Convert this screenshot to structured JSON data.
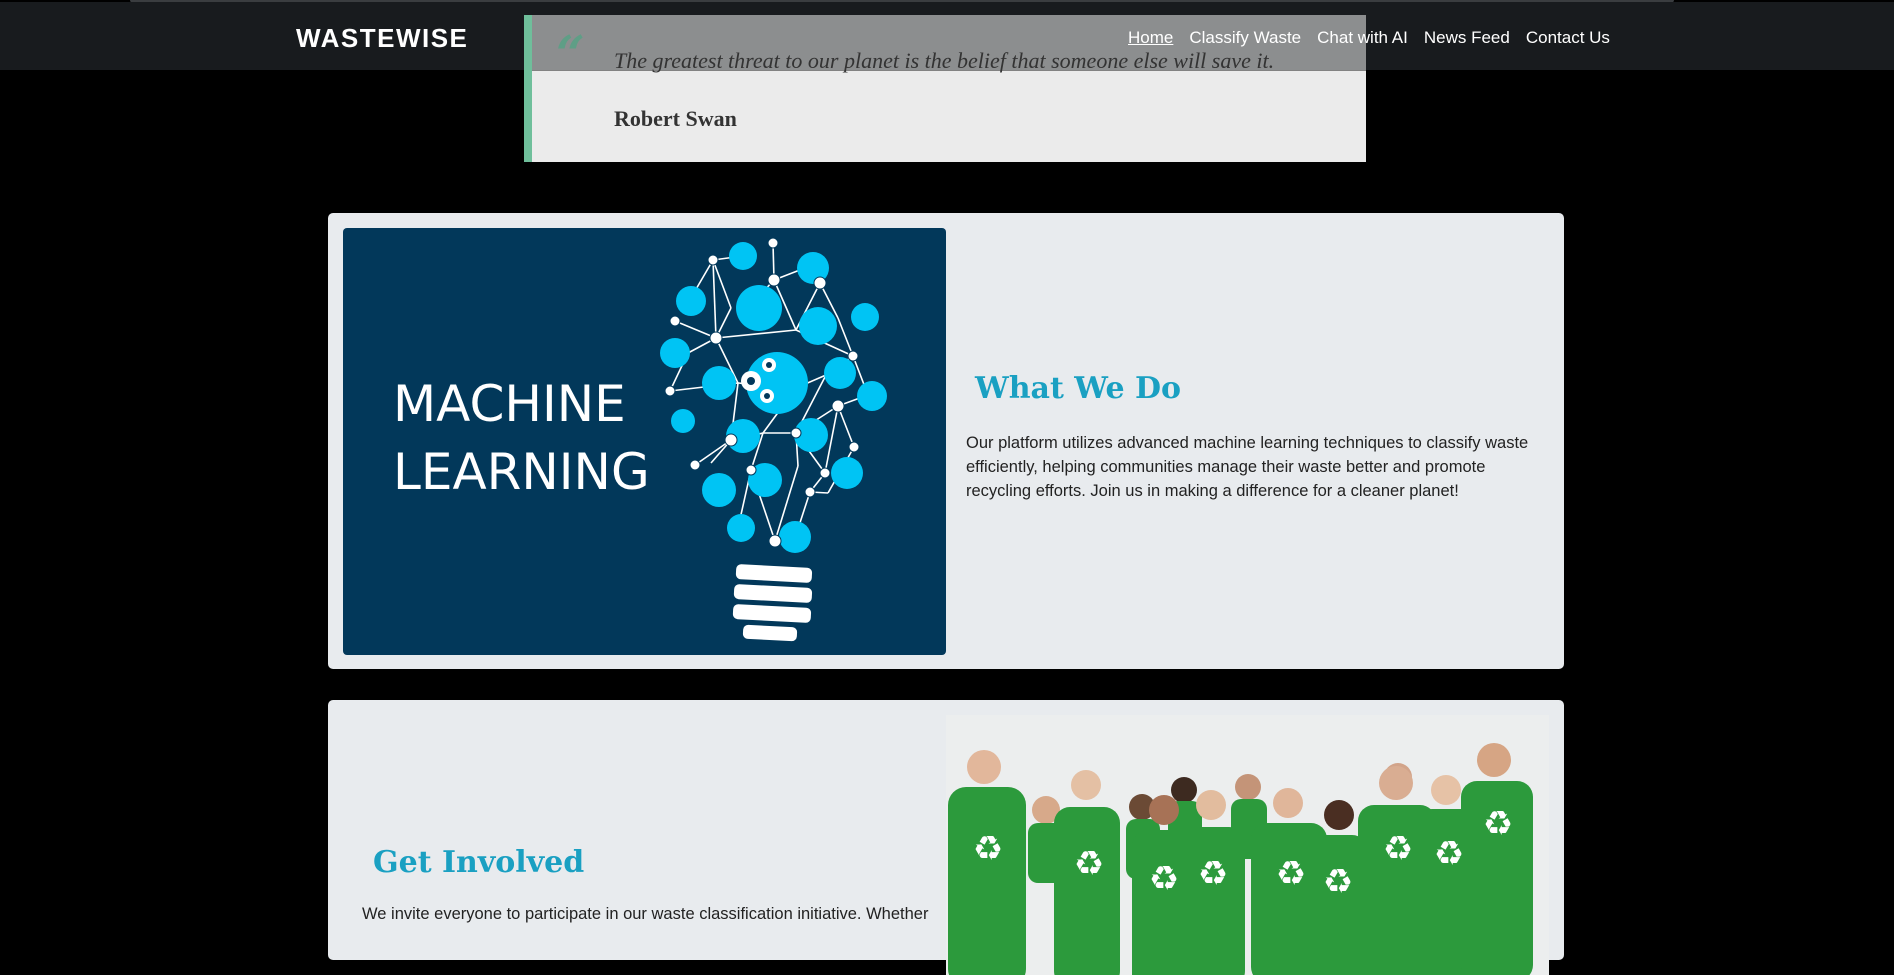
{
  "navbar": {
    "brand": "WASTEWISE",
    "links": [
      {
        "label": "Home",
        "active": true
      },
      {
        "label": "Classify Waste",
        "active": false
      },
      {
        "label": "Chat with AI",
        "active": false
      },
      {
        "label": "News Feed",
        "active": false
      },
      {
        "label": "Contact Us",
        "active": false
      }
    ]
  },
  "quote": {
    "mark": "“",
    "text": "The greatest threat to our planet is the belief that someone else will save it.",
    "author": "Robert Swan"
  },
  "what_we_do": {
    "image_text_line1": "MACHINE",
    "image_text_line2": "LEARNING",
    "title": "What We Do",
    "body": "Our platform utilizes advanced machine learning techniques to classify waste efficiently, helping communities manage their waste better and promote recycling efforts. Join us in making a difference for a cleaner planet!"
  },
  "get_involved": {
    "title": "Get Involved",
    "body": "We invite everyone to participate in our waste classification initiative. Whether"
  },
  "colors": {
    "accent": "#1aa0c2",
    "navbar_bg": "#181b1e",
    "card_bg": "#e8ebee",
    "quote_border": "#6fbf9b",
    "ml_bg": "#02385a",
    "ml_node": "#00c4f4",
    "tshirt_green": "#2c9a3c"
  }
}
